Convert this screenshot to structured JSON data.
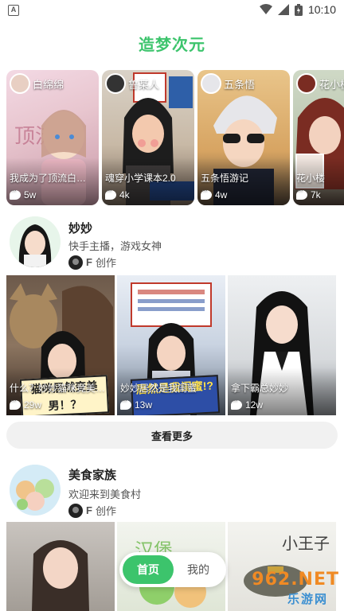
{
  "status_bar": {
    "left_icon": "A",
    "time": "10:10",
    "icons": [
      "wifi-icon",
      "signal-icon",
      "battery-icon"
    ]
  },
  "header": {
    "title": "造梦次元"
  },
  "colors": {
    "accent": "#3cc46c",
    "watermark_orange": "#f08a24",
    "watermark_blue": "#3b8fd1"
  },
  "characters": [
    {
      "name": "白绵绵",
      "desc": "我成为了顶流白…",
      "count": "5w"
    },
    {
      "name": "鲁某人",
      "desc": "魂穿小学课本2.0",
      "count": "4k"
    },
    {
      "name": "五条悟",
      "desc": "五条悟游记",
      "count": "4w"
    },
    {
      "name": "花小楼",
      "desc": "花小楼",
      "count": "7k"
    }
  ],
  "creators": [
    {
      "name": "妙妙",
      "bio": "快手主播，游戏女神",
      "by": "F",
      "by_suffix": "创作",
      "stories": [
        {
          "title": "什么？妙妙猫咪竟美男？",
          "count": "29w",
          "sign": "猫咪居然变美男！？"
        },
        {
          "title": "妙妙居然是我闺蜜",
          "count": "13w",
          "sign": "居然是我闺蜜!?"
        },
        {
          "title": "拿下霸总妙妙",
          "count": "12w",
          "sign": ""
        }
      ],
      "more": "查看更多"
    },
    {
      "name": "美食家族",
      "bio": "欢迎来到美食村",
      "by": "F",
      "by_suffix": "创作",
      "stories": [
        {
          "title": "",
          "count": "",
          "sign": ""
        },
        {
          "title": "",
          "count": "",
          "sign": ""
        },
        {
          "title": "",
          "count": "",
          "sign": ""
        }
      ]
    }
  ],
  "bottom_nav": {
    "home": "首页",
    "mine": "我的"
  },
  "watermark": {
    "main": "962.NET",
    "sub": "乐游网"
  }
}
